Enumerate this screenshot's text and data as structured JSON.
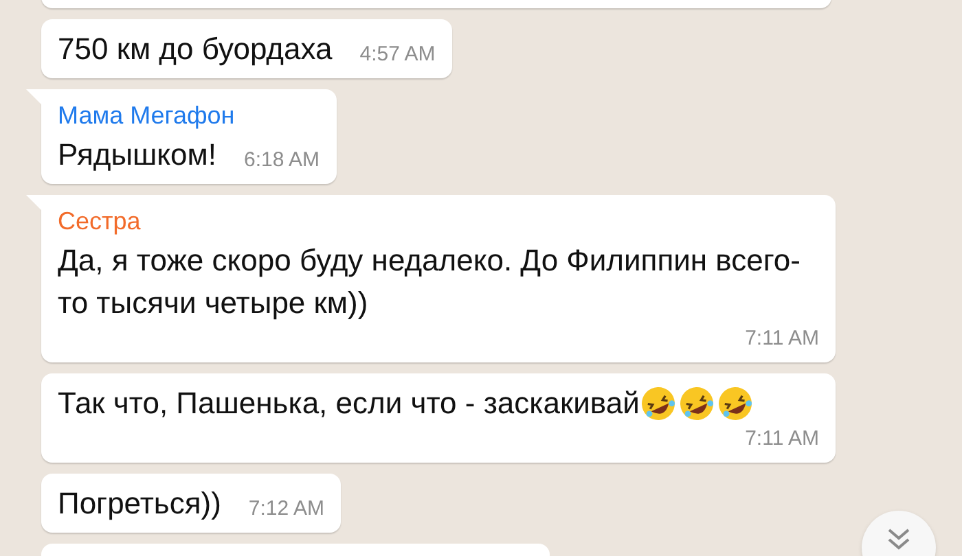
{
  "messages": [
    {
      "text": "750 км до буордаха",
      "time": "4:57 AM",
      "tail": false
    },
    {
      "sender": {
        "name": "Мама Мегафон",
        "color": "#1f7aec"
      },
      "text": "Рядышком!",
      "time": "6:18 AM",
      "tail": true
    },
    {
      "sender": {
        "name": "Сестра",
        "color": "#f26b2a"
      },
      "text": "Да, я тоже скоро буду недалеко. До Филиппин всего-то тысячи четыре км))",
      "time": "7:11 AM",
      "tail": true
    },
    {
      "text": "Так что, Пашенька, если что - заскакивай",
      "emojis": [
        {
          "kind": "rofl"
        },
        {
          "kind": "rofl"
        },
        {
          "kind": "rofl"
        }
      ],
      "time": "7:11 AM",
      "tail": false
    },
    {
      "text": "Погреться))",
      "time": "7:12 AM",
      "tail": false
    }
  ]
}
